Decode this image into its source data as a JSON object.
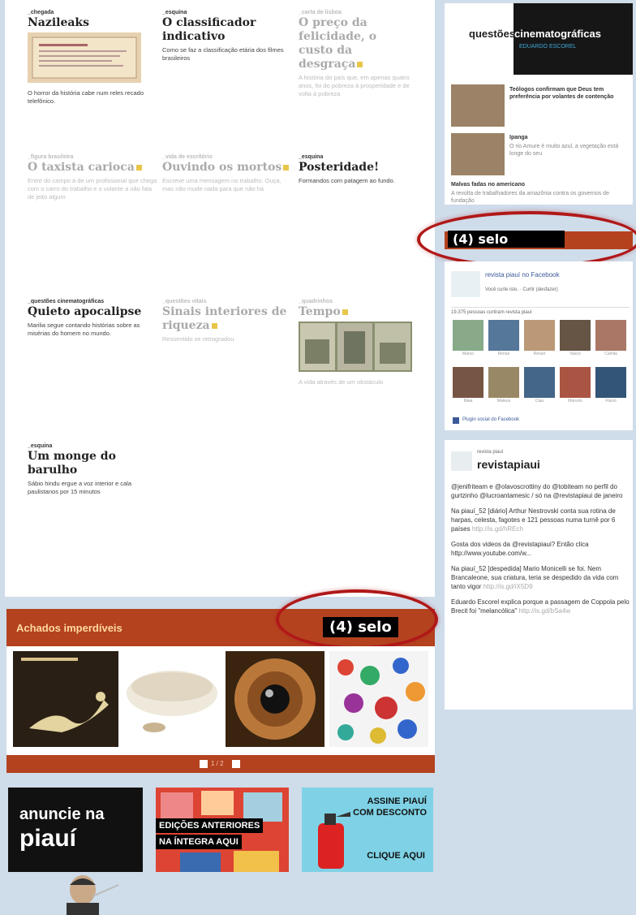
{
  "articles": [
    {
      "kicker": "_chegada",
      "title": "Nazileaks",
      "desc": "O horror da história cabe num reles recado telefônico.",
      "faded": false,
      "mark": false
    },
    {
      "kicker": "_esquina",
      "title": "O classificador indicativo",
      "desc": "Como se faz a classificação etária dos filmes brasileiros",
      "faded": false,
      "mark": false
    },
    {
      "kicker": "_carta de lisboa",
      "title": "O preço da felicidade, o custo da desgraça",
      "desc": "A história do país que, em apenas quatro anos, foi do pobreza à prosperidade e de volta à pobreza",
      "faded": true,
      "mark": true
    },
    {
      "kicker": "_figura brasileira",
      "title": "O taxista carioca",
      "desc": "Entre do campo à de um profissional que chega com o carro do trabalho e o volante a não fala de jeito algum",
      "faded": true,
      "mark": true
    },
    {
      "kicker": "_vida de escritório",
      "title": "Ouvindo os mortos",
      "desc": "Escreve uma mensagem no trabalho. Ouça, mas não mude nada para que não há",
      "faded": true,
      "mark": true
    },
    {
      "kicker": "_esquina",
      "title": "Posteridade!",
      "desc": "Formandos com patagem ao fundo.",
      "faded": false,
      "mark": false
    },
    {
      "kicker": "_questões cinematográficas",
      "title": "Quieto apocalipse",
      "desc": "Marilia segue contando histórias sobre as misérias do homem no mundo.",
      "faded": false,
      "mark": false
    },
    {
      "kicker": "_questões vitais",
      "title": "Sinais interiores de riqueza",
      "desc": "Ressentido se retrogradou",
      "faded": true,
      "mark": true
    },
    {
      "kicker": "_quadrinhos",
      "title": "Tempo",
      "desc": "A vida através de um obstáculo",
      "faded": true,
      "mark": true
    },
    {
      "kicker": "_esquina",
      "title": "Um monge do barulho",
      "desc": "Sábio hindu ergue a voz interior e cala paulistanos por 15 minutos",
      "faded": false,
      "mark": false
    }
  ],
  "achados": {
    "title": "Achados imperdíveis",
    "selo": "(4) selo",
    "pager": "1 / 2"
  },
  "banners": {
    "anuncie_line1": "anuncie na",
    "anuncie_line2": "piauí",
    "edicoes_line1": "EDIÇÕES ANTERIORES",
    "edicoes_line2": "NA ÍNTEGRA AQUI",
    "assine_line1": "ASSINE PIAUÍ",
    "assine_line2": "COM DESCONTO",
    "assine_cta": "CLIQUE AQUI"
  },
  "sidebar": {
    "qc_word1": "questões",
    "qc_word2": "cinematográficas",
    "qc_author": "EDUARDO ESCOREL",
    "posts": [
      {
        "title": "Teólogos confirmam que Deus tem preferência por volantes de contenção",
        "desc": ""
      },
      {
        "title": "Ipanga",
        "desc": "O rio Amure é muito azul, a vegetação está longe do seu"
      }
    ],
    "extra_title": "Malvas fadas no americano",
    "extra_desc": "A revolta de trabalhadores da amazônia contra os governos de fundação",
    "selo": "(4) selo",
    "fb": {
      "page": "revista piauí no Facebook",
      "liked": "Você curte isto. · Curtir (desfazer)",
      "count": "19.375 pessoas curtiram revista piauí",
      "names": [
        "Marco",
        "Renan",
        "Renan",
        "Vasco",
        "Camila",
        "Maia",
        "Mateus",
        "Clau",
        "Marcelo",
        "Flavio"
      ],
      "plugin": "Plugin social do Facebook"
    },
    "twitter": {
      "label": "revista piauí",
      "handle": "revistapiaui",
      "t1": "@jenifriteam e @olavoscrottiny do @tobiteam no perfil do gurtzinho @lucroantamesic / só na @revistapiaui de janeiro",
      "t2": "Na piauí_52 [diário] Arthur Nestrovski conta sua rotina de harpas, celesta, fagotes e 121 pessoas numa turnê por 6 países",
      "t2url": "http://is.gd/hREch",
      "t3": "Gosta dos videos da @revistapiaui? Então clica http://www.youtube.com/w...",
      "t4": "Na piauí_52 [despedida] Mario Monicelli se foi. Nem Brancaleone, sua criatura, teria se despedido da vida com tanto vigor",
      "t4url": "http://is.gd/iX5D9",
      "t5": "Eduardo Escorel explica porque a passagem de Coppola pelo Brecit foi \"melancólica\"",
      "t5url": "http://is.gd/bSa4w"
    }
  },
  "colors": {
    "brand_red": "#b4421f",
    "annotation_red": "#b01818",
    "background": "#cfdcea"
  }
}
